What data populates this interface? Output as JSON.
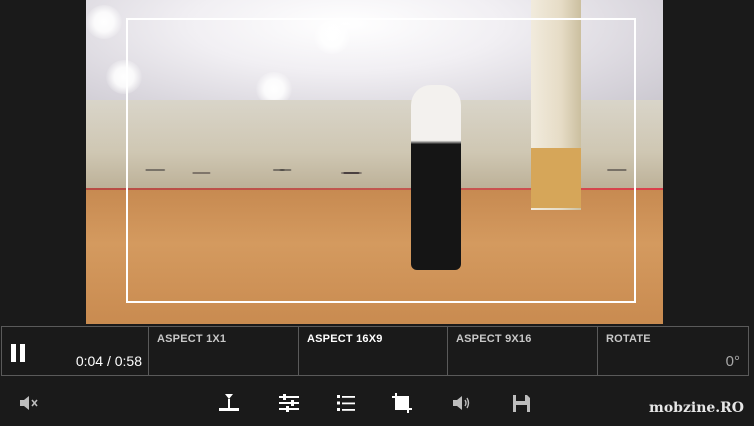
{
  "player": {
    "time_display": "0:04 / 0:58",
    "play_state": "playing"
  },
  "crop_options": [
    {
      "label": "ASPECT 1X1",
      "selected": false
    },
    {
      "label": "ASPECT 16X9",
      "selected": true
    },
    {
      "label": "ASPECT 9X16",
      "selected": false
    },
    {
      "label": "ROTATE",
      "selected": false
    }
  ],
  "rotate": {
    "value": "0°"
  },
  "toolbar": {
    "icons": [
      "mute-icon",
      "trim-icon",
      "adjust-icon",
      "list-icon",
      "crop-icon",
      "volume-icon",
      "save-icon"
    ]
  },
  "watermark": "mobzine.RO",
  "colors": {
    "background": "#1a1a1a",
    "border": "#5a5a5a",
    "text": "#ffffff",
    "muted_text": "#c8c8c8"
  }
}
